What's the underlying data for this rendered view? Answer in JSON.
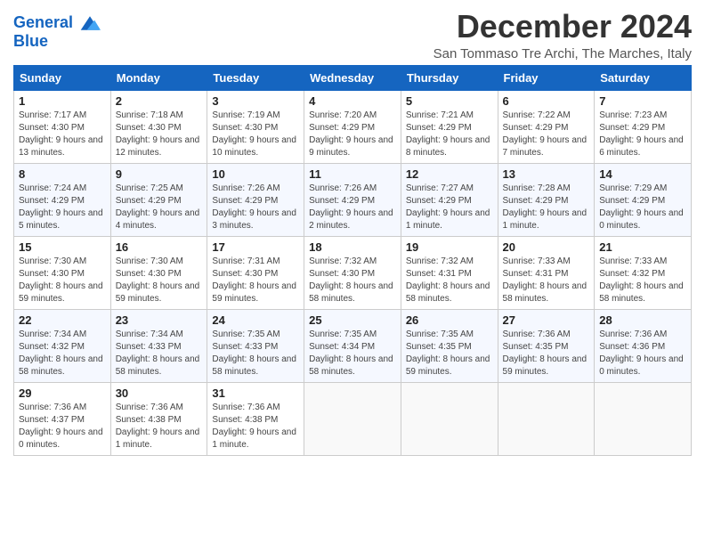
{
  "header": {
    "logo_line1": "General",
    "logo_line2": "Blue",
    "month_title": "December 2024",
    "subtitle": "San Tommaso Tre Archi, The Marches, Italy"
  },
  "weekdays": [
    "Sunday",
    "Monday",
    "Tuesday",
    "Wednesday",
    "Thursday",
    "Friday",
    "Saturday"
  ],
  "weeks": [
    [
      {
        "day": "1",
        "info": "Sunrise: 7:17 AM\nSunset: 4:30 PM\nDaylight: 9 hours and 13 minutes."
      },
      {
        "day": "2",
        "info": "Sunrise: 7:18 AM\nSunset: 4:30 PM\nDaylight: 9 hours and 12 minutes."
      },
      {
        "day": "3",
        "info": "Sunrise: 7:19 AM\nSunset: 4:30 PM\nDaylight: 9 hours and 10 minutes."
      },
      {
        "day": "4",
        "info": "Sunrise: 7:20 AM\nSunset: 4:29 PM\nDaylight: 9 hours and 9 minutes."
      },
      {
        "day": "5",
        "info": "Sunrise: 7:21 AM\nSunset: 4:29 PM\nDaylight: 9 hours and 8 minutes."
      },
      {
        "day": "6",
        "info": "Sunrise: 7:22 AM\nSunset: 4:29 PM\nDaylight: 9 hours and 7 minutes."
      },
      {
        "day": "7",
        "info": "Sunrise: 7:23 AM\nSunset: 4:29 PM\nDaylight: 9 hours and 6 minutes."
      }
    ],
    [
      {
        "day": "8",
        "info": "Sunrise: 7:24 AM\nSunset: 4:29 PM\nDaylight: 9 hours and 5 minutes."
      },
      {
        "day": "9",
        "info": "Sunrise: 7:25 AM\nSunset: 4:29 PM\nDaylight: 9 hours and 4 minutes."
      },
      {
        "day": "10",
        "info": "Sunrise: 7:26 AM\nSunset: 4:29 PM\nDaylight: 9 hours and 3 minutes."
      },
      {
        "day": "11",
        "info": "Sunrise: 7:26 AM\nSunset: 4:29 PM\nDaylight: 9 hours and 2 minutes."
      },
      {
        "day": "12",
        "info": "Sunrise: 7:27 AM\nSunset: 4:29 PM\nDaylight: 9 hours and 1 minute."
      },
      {
        "day": "13",
        "info": "Sunrise: 7:28 AM\nSunset: 4:29 PM\nDaylight: 9 hours and 1 minute."
      },
      {
        "day": "14",
        "info": "Sunrise: 7:29 AM\nSunset: 4:29 PM\nDaylight: 9 hours and 0 minutes."
      }
    ],
    [
      {
        "day": "15",
        "info": "Sunrise: 7:30 AM\nSunset: 4:30 PM\nDaylight: 8 hours and 59 minutes."
      },
      {
        "day": "16",
        "info": "Sunrise: 7:30 AM\nSunset: 4:30 PM\nDaylight: 8 hours and 59 minutes."
      },
      {
        "day": "17",
        "info": "Sunrise: 7:31 AM\nSunset: 4:30 PM\nDaylight: 8 hours and 59 minutes."
      },
      {
        "day": "18",
        "info": "Sunrise: 7:32 AM\nSunset: 4:30 PM\nDaylight: 8 hours and 58 minutes."
      },
      {
        "day": "19",
        "info": "Sunrise: 7:32 AM\nSunset: 4:31 PM\nDaylight: 8 hours and 58 minutes."
      },
      {
        "day": "20",
        "info": "Sunrise: 7:33 AM\nSunset: 4:31 PM\nDaylight: 8 hours and 58 minutes."
      },
      {
        "day": "21",
        "info": "Sunrise: 7:33 AM\nSunset: 4:32 PM\nDaylight: 8 hours and 58 minutes."
      }
    ],
    [
      {
        "day": "22",
        "info": "Sunrise: 7:34 AM\nSunset: 4:32 PM\nDaylight: 8 hours and 58 minutes."
      },
      {
        "day": "23",
        "info": "Sunrise: 7:34 AM\nSunset: 4:33 PM\nDaylight: 8 hours and 58 minutes."
      },
      {
        "day": "24",
        "info": "Sunrise: 7:35 AM\nSunset: 4:33 PM\nDaylight: 8 hours and 58 minutes."
      },
      {
        "day": "25",
        "info": "Sunrise: 7:35 AM\nSunset: 4:34 PM\nDaylight: 8 hours and 58 minutes."
      },
      {
        "day": "26",
        "info": "Sunrise: 7:35 AM\nSunset: 4:35 PM\nDaylight: 8 hours and 59 minutes."
      },
      {
        "day": "27",
        "info": "Sunrise: 7:36 AM\nSunset: 4:35 PM\nDaylight: 8 hours and 59 minutes."
      },
      {
        "day": "28",
        "info": "Sunrise: 7:36 AM\nSunset: 4:36 PM\nDaylight: 9 hours and 0 minutes."
      }
    ],
    [
      {
        "day": "29",
        "info": "Sunrise: 7:36 AM\nSunset: 4:37 PM\nDaylight: 9 hours and 0 minutes."
      },
      {
        "day": "30",
        "info": "Sunrise: 7:36 AM\nSunset: 4:38 PM\nDaylight: 9 hours and 1 minute."
      },
      {
        "day": "31",
        "info": "Sunrise: 7:36 AM\nSunset: 4:38 PM\nDaylight: 9 hours and 1 minute."
      },
      null,
      null,
      null,
      null
    ]
  ]
}
